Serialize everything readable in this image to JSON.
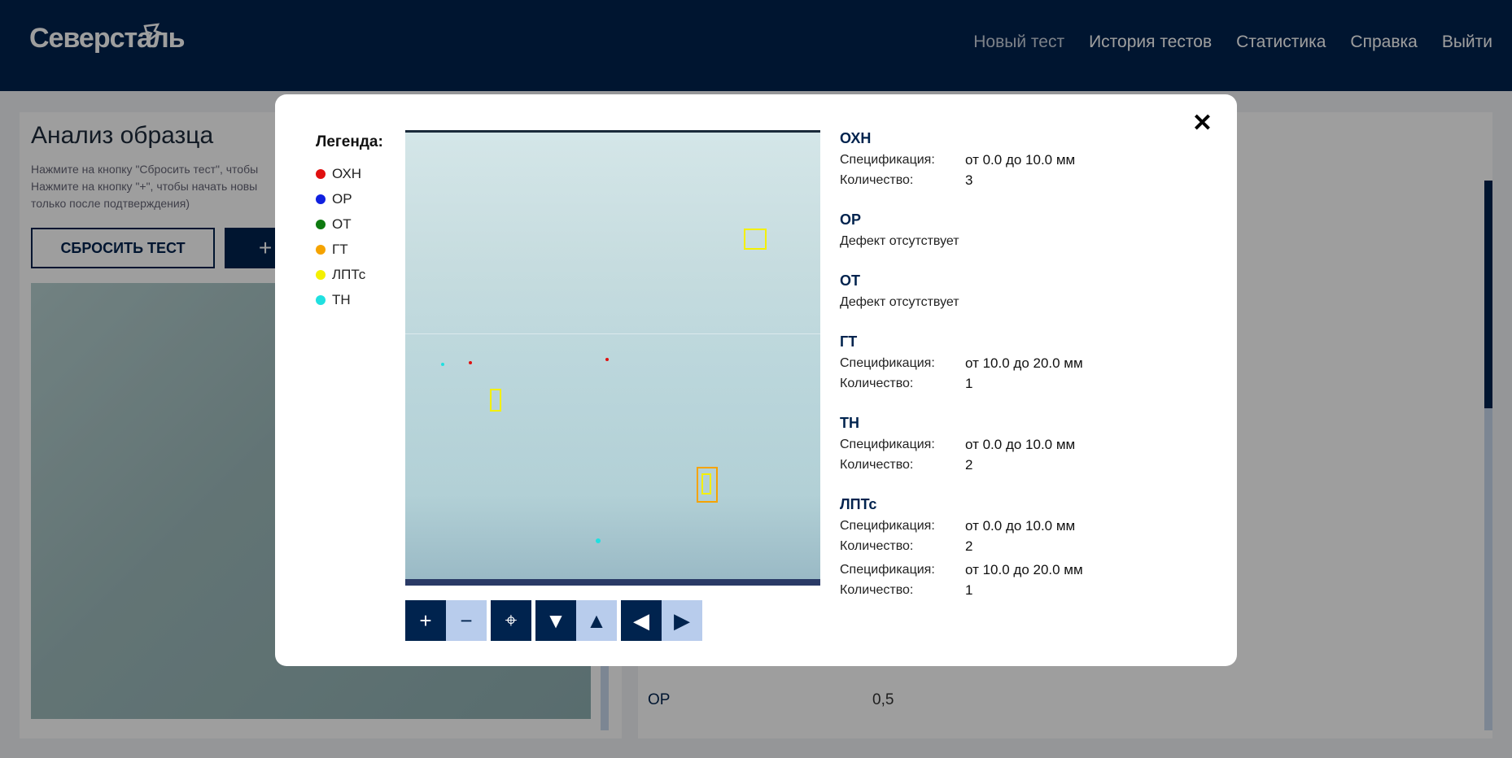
{
  "header": {
    "logo": "Северсталь",
    "nav": [
      {
        "label": "Новый тест",
        "active": true
      },
      {
        "label": "История тестов",
        "active": false
      },
      {
        "label": "Статистика",
        "active": false
      },
      {
        "label": "Справка",
        "active": false
      },
      {
        "label": "Выйти",
        "active": false
      }
    ]
  },
  "page": {
    "title": "Анализ образца",
    "hint_line1": "Нажмите на кнопку \"Сбросить тест\", чтобы",
    "hint_line2": "Нажмите на кнопку \"+\", чтобы начать новы",
    "hint_line3": "только после подтверждения)",
    "reset_button": "СБРОСИТЬ ТЕСТ",
    "plus_button": "+",
    "table_row": {
      "name": "ОР",
      "value": "0,5"
    }
  },
  "modal": {
    "close": "✕",
    "legend_title": "Легенда:",
    "legend": [
      {
        "label": "ОХН",
        "color": "#e01010"
      },
      {
        "label": "ОР",
        "color": "#1020e0"
      },
      {
        "label": "ОТ",
        "color": "#0e7a10"
      },
      {
        "label": "ГТ",
        "color": "#f5a300"
      },
      {
        "label": "ЛПТс",
        "color": "#f4f000"
      },
      {
        "label": "ТН",
        "color": "#20e0e0"
      }
    ],
    "controls": {
      "zoom_in": "+",
      "zoom_out": "−",
      "center": "⌖",
      "down": "▼",
      "up": "▲",
      "left": "◀",
      "right": "▶"
    },
    "spec_key": "Спецификация:",
    "count_key": "Количество:",
    "defects": [
      {
        "name": "ОХН",
        "entries": [
          {
            "spec": "от 0.0 до 10.0 мм",
            "count": "3"
          }
        ]
      },
      {
        "name": "ОР",
        "absent": "Дефект отсутствует"
      },
      {
        "name": "ОТ",
        "absent": "Дефект отсутствует"
      },
      {
        "name": "ГТ",
        "entries": [
          {
            "spec": "от 10.0 до 20.0 мм",
            "count": "1"
          }
        ]
      },
      {
        "name": "ТН",
        "entries": [
          {
            "spec": "от 0.0 до 10.0 мм",
            "count": "2"
          }
        ]
      },
      {
        "name": "ЛПТс",
        "entries": [
          {
            "spec": "от 0.0 до 10.0 мм",
            "count": "2"
          },
          {
            "spec": "от 10.0 до 20.0 мм",
            "count": "1"
          }
        ]
      }
    ]
  }
}
